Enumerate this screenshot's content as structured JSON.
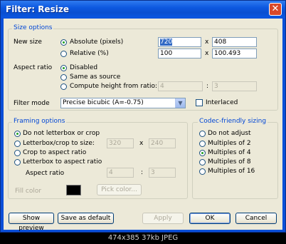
{
  "window": {
    "title": "Filter: Resize",
    "close_glyph": "✕"
  },
  "size_options": {
    "legend": "Size options",
    "new_size_label": "New size",
    "absolute_label": "Absolute (pixels)",
    "relative_label": "Relative (%)",
    "abs_width": "720",
    "abs_height": "408",
    "rel_width": "100",
    "rel_height": "100.493",
    "x_sep": "x",
    "aspect_label": "Aspect ratio",
    "aspect_disabled": "Disabled",
    "aspect_same": "Same as source",
    "aspect_compute": "Compute height from ratio:",
    "ratio_a": "4",
    "ratio_b": "3",
    "colon": ":",
    "filter_mode_label": "Filter mode",
    "filter_mode_value": "Precise bicubic (A=-0.75)",
    "interlaced_label": "Interlaced"
  },
  "framing": {
    "legend": "Framing options",
    "opt_none": "Do not letterbox or crop",
    "opt_letterbox": "Letterbox/crop to size:",
    "opt_crop": "Crop to aspect ratio",
    "opt_letterbox_aspect": "Letterbox to aspect ratio",
    "lb_w": "320",
    "lb_h": "240",
    "x_sep": "x",
    "aspect_label": "Aspect ratio",
    "ar_a": "4",
    "ar_b": "3",
    "colon": ":",
    "fill_color_label": "Fill color",
    "fill_color": "#000000",
    "pick_color": "Pick color..."
  },
  "codec": {
    "legend": "Codec-friendly sizing",
    "options": [
      "Do not adjust",
      "Multiples of 2",
      "Multiples of 4",
      "Multiples of 8",
      "Multiples of 16"
    ]
  },
  "buttons": {
    "show_preview": "Show preview",
    "save_default": "Save as default",
    "apply": "Apply",
    "ok": "OK",
    "cancel": "Cancel"
  },
  "caption": "474x385 37kb JPEG"
}
